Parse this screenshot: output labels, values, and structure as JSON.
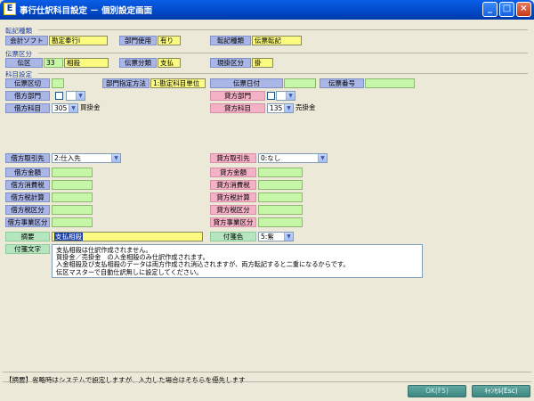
{
  "window": {
    "title": "事行仕訳科目設定 － 個別設定画面",
    "icon_glyph": "E",
    "min_glyph": "_",
    "max_glyph": "□",
    "close_glyph": "×"
  },
  "sections": {
    "tenki": "転記種類",
    "denpyo": "伝票区分",
    "kamoku": "科目設定"
  },
  "tenki": {
    "kaikei_label": "会計ソフト",
    "kaikei_value": "勘定奉行i",
    "bumon_label": "部門使用",
    "bumon_value": "有り",
    "tenki_label": "転記種類",
    "tenki_value": "伝票転記"
  },
  "denpyo": {
    "denku_label": "伝区",
    "denku_code": "33",
    "denku_name": "相殺",
    "bunrui_label": "伝票分類",
    "bunrui_value": "支払",
    "genkake_label": "現掛区分",
    "genkake_value": "掛"
  },
  "kamoku": {
    "kugiri_label": "伝票区切",
    "kugiri_value": "",
    "shitei_label": "部門指定方法",
    "shitei_value": "1:勘定科目単位",
    "hiduke_label": "伝票日付",
    "hiduke_value": "",
    "bango_label": "伝票番号",
    "bango_value": "",
    "kari_bumon_label": "借方部門",
    "kashi_bumon_label": "貸方部門",
    "kari_kamoku_label": "借方科目",
    "kari_kamoku_code": "305",
    "kari_kamoku_name": "買掛金",
    "kashi_kamoku_label": "貸方科目",
    "kashi_kamoku_code": "135",
    "kashi_kamoku_name": "売掛金",
    "kari_torihiki_label": "借方取引先",
    "kari_torihiki_value": "2:仕入先",
    "kashi_torihiki_label": "貸方取引先",
    "kashi_torihiki_value": "0:なし",
    "kari_rows": [
      "借方金額",
      "借方消費税",
      "借方税計算",
      "借方税区分",
      "借方事業区分"
    ],
    "kashi_rows": [
      "貸方金額",
      "貸方消費税",
      "貸方税計算",
      "貸方税区分",
      "貸方事業区分"
    ],
    "tekiyo_label": "摘要",
    "tekiyo_value": "支払相殺",
    "fusen_label": "付箋色",
    "fusen_value": "5:紫",
    "fusen_moji_label": "付箋文字",
    "memo_lines": [
      "支払相殺は仕訳作成されません。",
      "買掛金／売掛金　の入金相殺のみ仕訳作成されます。",
      "入金相殺及び支払相殺のデータは両方作成され消込されますが、両方転記すると二重になるからです。",
      "伝区マスターで自動仕訳無しに設定してください。"
    ]
  },
  "status": {
    "text": "【摘要】省略時はシステムで設定しますが、入力した場合はそちらを優先します"
  },
  "buttons": {
    "ok": "OK(F5)",
    "cancel": "ｷｬﾝｾﾙ(Esc)"
  },
  "colors": {
    "title_bar": "#0148c8",
    "label_blue": "#aab6e6",
    "label_pink": "#f4b2c6",
    "value_yellow": "#fbfb82",
    "value_green": "#c6f6a8",
    "button_teal": "#3d8781"
  }
}
